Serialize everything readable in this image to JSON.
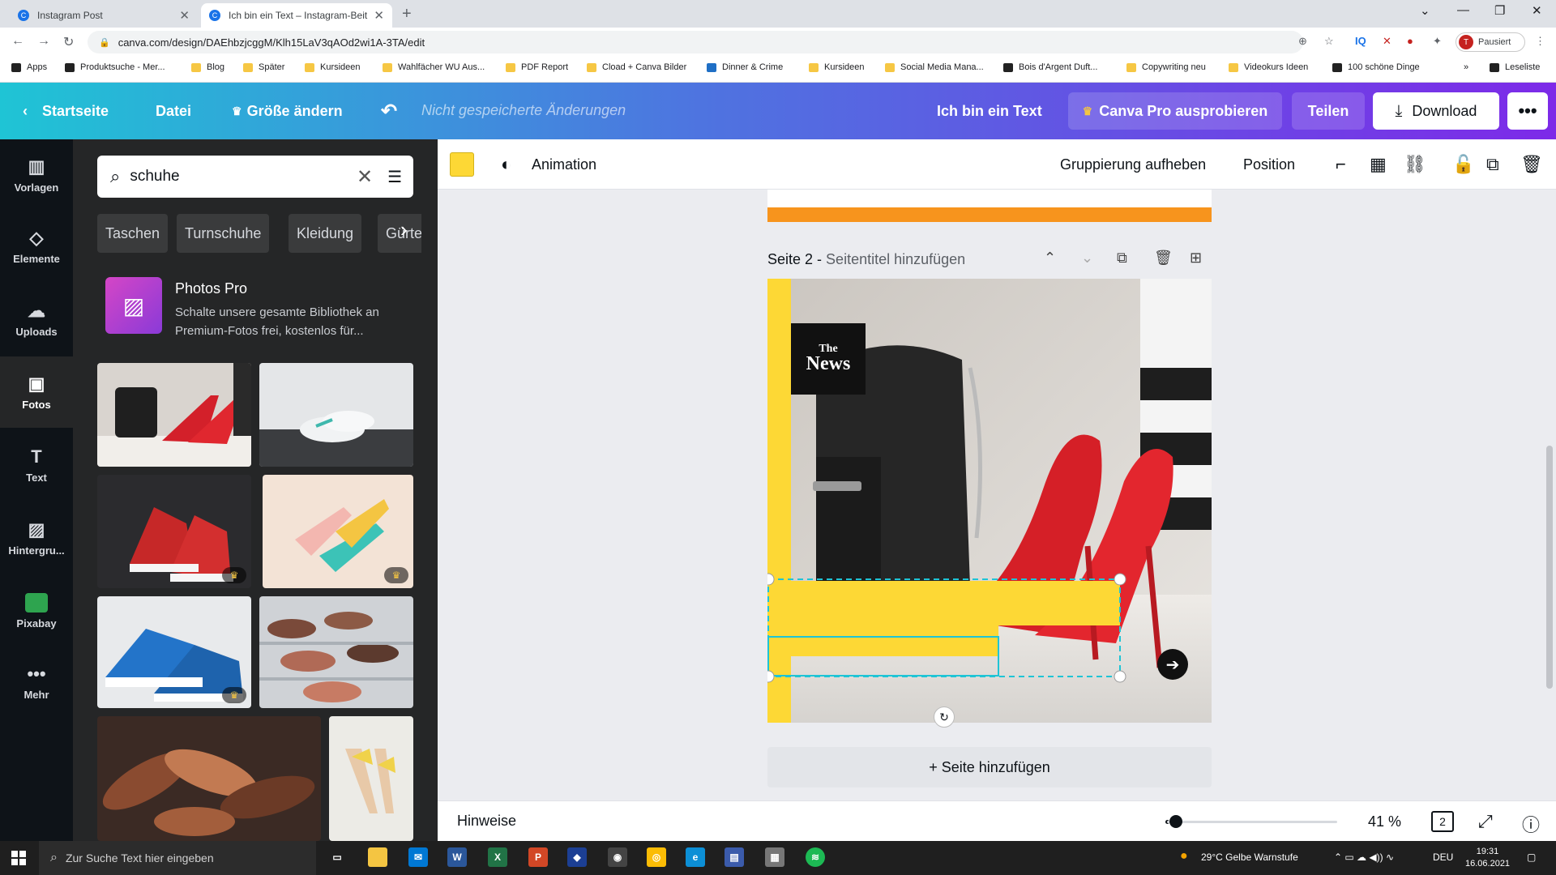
{
  "browser": {
    "tabs": [
      {
        "title": "Instagram Post"
      },
      {
        "title": "Ich bin ein Text – Instagram-Beit"
      }
    ],
    "url": "canva.com/design/DAEhbzjcggM/Klh15LaV3qAOd2wi1A-3TA/edit",
    "profile_label": "Pausiert",
    "profile_initial": "T",
    "bookmarks": [
      "Apps",
      "Produktsuche - Mer...",
      "Blog",
      "Später",
      "Kursideen",
      "Wahlfächer WU Aus...",
      "PDF Report",
      "Cload + Canva Bilder",
      "Dinner & Crime",
      "Kursideen",
      "Social Media Mana...",
      "Bois d'Argent Duft...",
      "Copywriting neu",
      "Videokurs Ideen",
      "100 schöne Dinge"
    ],
    "reading_list": "Leseliste"
  },
  "header": {
    "home": "Startseite",
    "file": "Datei",
    "resize": "Größe ändern",
    "unsaved": "Nicht gespeicherte Änderungen",
    "design_title": "Ich bin ein Text",
    "pro": "Canva Pro ausprobieren",
    "share": "Teilen",
    "download": "Download",
    "more": "•••"
  },
  "rail": [
    {
      "label": "Vorlagen",
      "icon": "templates-icon"
    },
    {
      "label": "Elemente",
      "icon": "elements-icon"
    },
    {
      "label": "Uploads",
      "icon": "upload-icon"
    },
    {
      "label": "Fotos",
      "icon": "photos-icon"
    },
    {
      "label": "Text",
      "icon": "text-icon"
    },
    {
      "label": "Hintergru...",
      "icon": "background-icon"
    },
    {
      "label": "Pixabay",
      "icon": "pixabay-icon"
    },
    {
      "label": "Mehr",
      "icon": "more-icon"
    }
  ],
  "panel": {
    "search_value": "schuhe",
    "chips": [
      "Taschen",
      "Turnschuhe",
      "Kleidung",
      "Gürte"
    ],
    "promo_title": "Photos Pro",
    "promo_desc": "Schalte unsere gesamte Bibliothek an Premium-Fotos frei, kostenlos für..."
  },
  "toolbar": {
    "color": "#fdd835",
    "animation": "Animation",
    "ungroup": "Gruppierung aufheben",
    "position": "Position"
  },
  "canvas": {
    "page_label": "Seite 2 - ",
    "page_title_placeholder": "Seitentitel hinzufügen",
    "logo_text_small": "The",
    "logo_text_big": "News",
    "add_page": "+ Seite hinzufügen"
  },
  "bottom": {
    "notes": "Hinweise",
    "zoom": "41 %",
    "page_count": "2"
  },
  "taskbar": {
    "search_placeholder": "Zur Suche Text hier eingeben",
    "weather": "29°C  Gelbe Warnstufe",
    "lang": "DEU",
    "time": "19:31",
    "date": "16.06.2021"
  }
}
